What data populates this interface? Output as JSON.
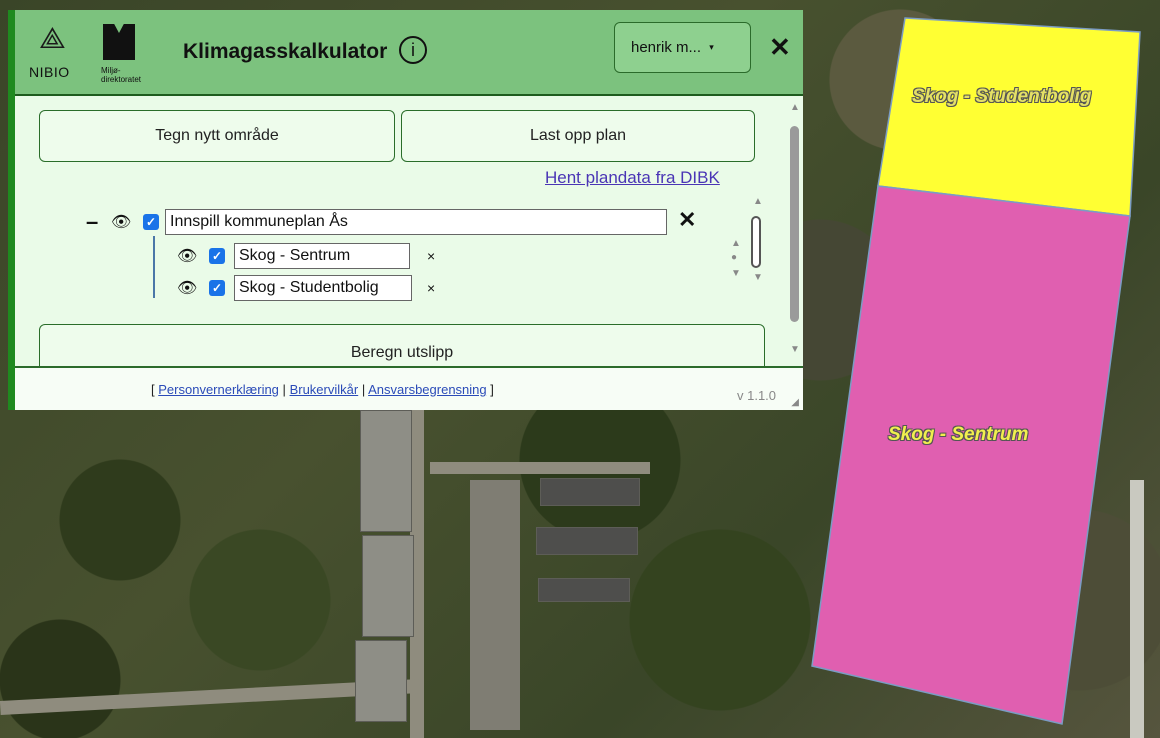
{
  "header": {
    "nibio_label": "NIBIO",
    "mdir_label": "Miljø-\ndirektoratet",
    "app_title": "Klimagasskalkulator",
    "info_glyph": "i",
    "user_label": "henrik m...",
    "caret": "▾",
    "close_glyph": "✕"
  },
  "actions": {
    "draw_new_area": "Tegn nytt område",
    "upload_plan": "Last opp plan",
    "fetch_dibk": "Hent plandata fra DIBK",
    "calculate": "Beregn utslipp"
  },
  "tree": {
    "collapse_glyph": "–",
    "eye_glyph": "👁",
    "check_glyph": "✓",
    "remove_big": "✕",
    "remove_small": "×",
    "root": {
      "name": "Innspill kommuneplan Ås",
      "checked": true,
      "visible": true
    },
    "children": [
      {
        "name": "Skog - Sentrum",
        "checked": true,
        "visible": true
      },
      {
        "name": "Skog - Studentbolig",
        "checked": true,
        "visible": true
      }
    ]
  },
  "footer": {
    "open_bracket": "[",
    "close_bracket": "]",
    "separator": "|",
    "links": [
      "Personvernerklæring",
      "Brukervilkår",
      "Ansvarsbegrensning"
    ],
    "version": "v 1.1.0"
  },
  "map": {
    "polygons": [
      {
        "label": "Skog - Studentbolig",
        "color": "#ffff33"
      },
      {
        "label": "Skog - Sentrum",
        "color": "#e05fb0"
      }
    ]
  },
  "colors": {
    "header_bg": "#7cc27e",
    "accent": "#1f8a1f",
    "panel_bg": "#eafbe8",
    "link": "#4a35b5"
  }
}
